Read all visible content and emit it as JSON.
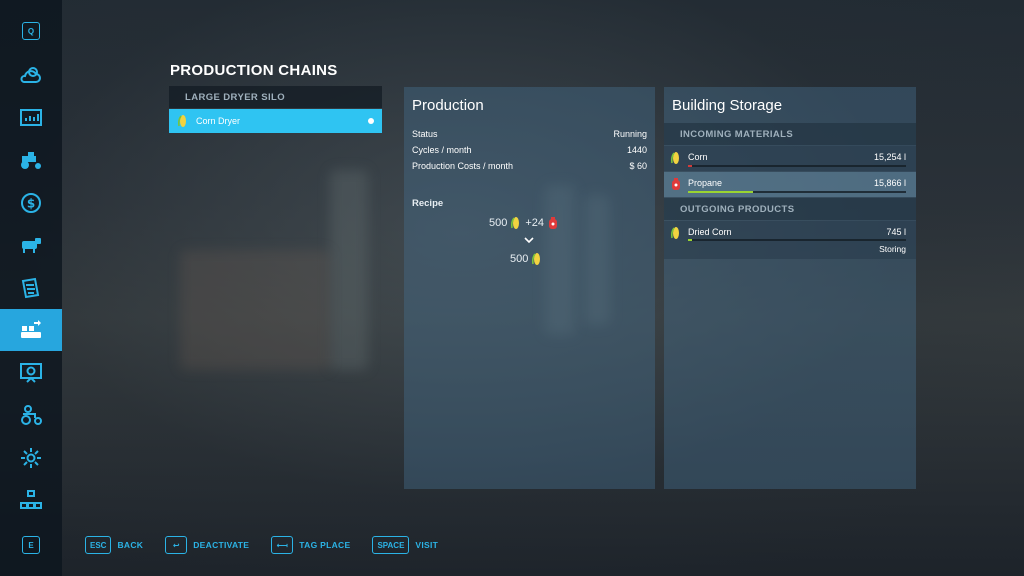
{
  "sidebar": {
    "top_key": "Q",
    "bottom_key": "E",
    "items": [
      {
        "icon": "weather-icon"
      },
      {
        "icon": "statistics-icon"
      },
      {
        "icon": "vehicles-icon"
      },
      {
        "icon": "finances-icon"
      },
      {
        "icon": "animals-icon"
      },
      {
        "icon": "contracts-icon"
      },
      {
        "icon": "production-icon",
        "active": true
      },
      {
        "icon": "help-icon"
      },
      {
        "icon": "garage-icon"
      },
      {
        "icon": "settings-icon"
      },
      {
        "icon": "hierarchy-icon"
      }
    ]
  },
  "page": {
    "title": "PRODUCTION CHAINS"
  },
  "list": {
    "header": "LARGE DRYER SILO",
    "items": [
      {
        "label": "Corn Dryer",
        "selected": true
      }
    ]
  },
  "production": {
    "title": "Production",
    "rows": [
      {
        "label": "Status",
        "value": "Running"
      },
      {
        "label": "Cycles / month",
        "value": "1440"
      },
      {
        "label": "Production Costs / month",
        "value": "$ 60"
      }
    ],
    "recipe_label": "Recipe",
    "recipe": {
      "input1": "500",
      "plus": "+24",
      "output": "500"
    }
  },
  "storage": {
    "title": "Building Storage",
    "incoming_header": "INCOMING MATERIALS",
    "incoming": [
      {
        "name": "Corn",
        "amount": "15,254 l",
        "fill": 0.02,
        "color": "#d23a3a"
      },
      {
        "name": "Propane",
        "amount": "15,866 l",
        "fill": 0.3,
        "color": "#9ad431"
      }
    ],
    "outgoing_header": "OUTGOING PRODUCTS",
    "outgoing": [
      {
        "name": "Dried Corn",
        "amount": "745 l",
        "fill": 0.02,
        "color": "#9ad431",
        "status": "Storing"
      }
    ]
  },
  "footer": [
    {
      "key": "ESC",
      "label": "BACK"
    },
    {
      "key": "↩",
      "label": "DEACTIVATE"
    },
    {
      "key": "⟻",
      "label": "TAG PLACE"
    },
    {
      "key": "SPACE",
      "label": "VISIT"
    }
  ],
  "colors": {
    "accent": "#2bb3e6",
    "selected": "#2fc4f2",
    "bar_red": "#d23a3a",
    "bar_green": "#9ad431"
  }
}
